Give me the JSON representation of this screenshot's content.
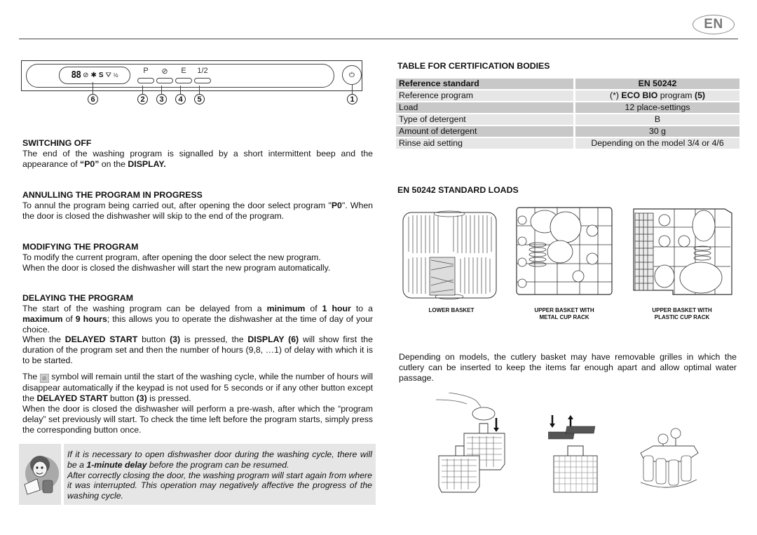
{
  "header": {
    "language_badge": "EN"
  },
  "control_panel": {
    "display_symbols": {
      "segments": "88",
      "clock": "⊘",
      "sun": "✱",
      "rinse": "S",
      "salt": "⛛",
      "half": "½"
    },
    "buttons": [
      {
        "label": "P",
        "number": "2"
      },
      {
        "label": "⊘",
        "number": "3"
      },
      {
        "label": "E",
        "number": "4"
      },
      {
        "label": "1/2",
        "number": "5"
      }
    ],
    "power_symbol": "⏻",
    "display_number": "6",
    "power_number": "1"
  },
  "sections": {
    "switching_off": {
      "title": "SWITCHING OFF",
      "text_a": "The end of the washing program is signalled by a short intermittent beep and the appearance of ",
      "text_b": "“P0”",
      "text_c": " on the ",
      "text_d": "DISPLAY."
    },
    "annulling": {
      "title": "ANNULLING THE PROGRAM IN PROGRESS",
      "text_a": "To annul the program being carried out, after opening the door select program \"",
      "text_b": "P0",
      "text_c": "\". When the door is closed the dishwasher will skip to the end of the program."
    },
    "modifying": {
      "title": "MODIFYING THE PROGRAM",
      "line1": "To modify the current program, after opening the door select the new program.",
      "line2": "When the door is closed the dishwasher will start the new program automatically."
    },
    "delaying": {
      "title": "DELAYING THE PROGRAM",
      "p1": [
        "The start of the washing program can be delayed from a ",
        "minimum",
        " of ",
        "1 hour",
        " to a ",
        "maximum",
        " of ",
        "9 hours",
        "; this allows you to operate the dishwasher at the time of day of your choice."
      ],
      "p2": [
        "When the ",
        "DELAYED START",
        " button ",
        "(3)",
        " is pressed, the ",
        "DISPLAY (6)",
        " will show first the duration of the program set and then the number of hours (9,8, …1) of delay with which it is to be started."
      ],
      "p3": [
        "The ",
        " symbol will remain until the start of the washing cycle, while the number of hours will disappear automatically if the keypad is not used for 5 seconds or if any other button except the ",
        "DELAYED START",
        " button ",
        "(3)",
        " is pressed."
      ],
      "p4": "When the door is closed the dishwasher will perform a pre-wash, after which the “program delay” set previously will start. To check the time left before the program starts, simply press the corresponding button once."
    },
    "tip": {
      "t1": "If it is necessary to open dishwasher door during the washing cycle, there will be a ",
      "t2": "1-minute delay",
      "t3": " before the program can be resumed.",
      "t4": "After correctly closing the door, the washing program will start again from where it was interrupted. This operation may negatively affective the progress of the washing cycle."
    }
  },
  "certification": {
    "title": "TABLE FOR CERTIFICATION BODIES",
    "header": {
      "label": "Reference standard",
      "value": "EN 50242"
    },
    "rows": [
      {
        "label": "Reference program",
        "value_parts": [
          "(*) ",
          "ECO BIO",
          " program ",
          "(5)"
        ]
      },
      {
        "label": "Load",
        "value": "12 place-settings"
      },
      {
        "label": "Type of detergent",
        "value": "B"
      },
      {
        "label": "Amount of detergent",
        "value": "30 g"
      },
      {
        "label": "Rinse aid setting",
        "value": "Depending on the model 3/4 or 4/6"
      }
    ]
  },
  "standard_loads": {
    "title": "EN 50242 STANDARD LOADS",
    "captions": [
      {
        "line1": "LOWER BASKET",
        "line2": ""
      },
      {
        "line1": "UPPER BASKET WITH",
        "line2": "METAL CUP RACK"
      },
      {
        "line1": "UPPER BASKET WITH",
        "line2": "PLASTIC CUP RACK"
      }
    ]
  },
  "cutlery": {
    "text": "Depending on models, the cutlery basket may have removable grilles in which the cutlery can be inserted to keep the items far enough apart and allow optimal water passage."
  }
}
